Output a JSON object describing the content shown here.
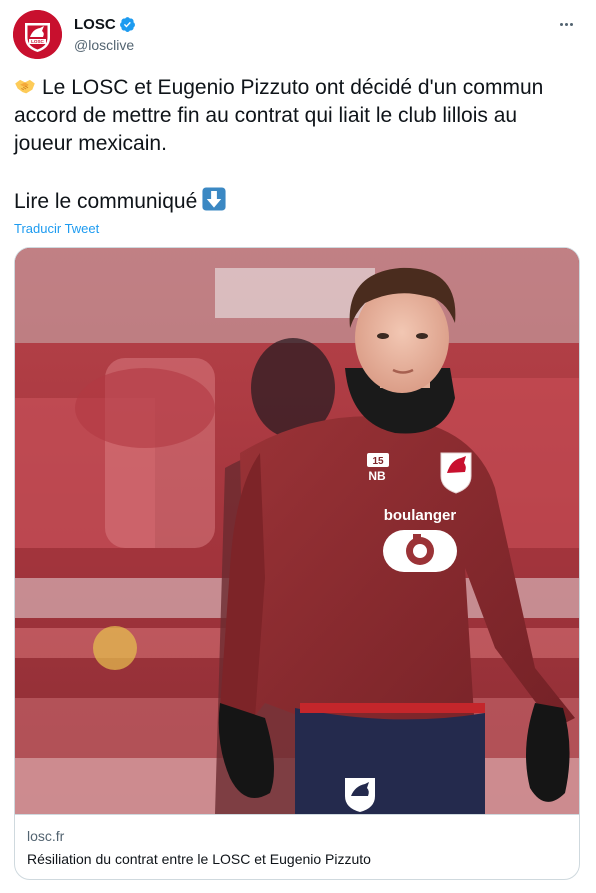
{
  "author": {
    "display_name": "LOSC",
    "handle": "@losclive",
    "verified_icon": "verified-badge-icon",
    "avatar_icon": "losc-crest-icon"
  },
  "tweet": {
    "line1": "Le LOSC et Eugenio Pizzuto ont décidé d'un commun accord de mettre fin au contrat qui liait le club lillois au joueur mexicain.",
    "line2": "Lire le communiqué",
    "leading_emoji": "handshake-emoji",
    "trailing_emoji": "down-arrow-emoji",
    "translate_label": "Traducir Tweet"
  },
  "card": {
    "domain": "losc.fr",
    "title": "Résiliation du contrat entre le LOSC et Eugenio Pizzuto",
    "image_icon": "player-photo",
    "kit": {
      "sponsor": "boulanger",
      "number_badge": "15",
      "crest": "LOSC"
    }
  },
  "colors": {
    "accent": "#1d9bf0",
    "club_red": "#c8102e",
    "text": "#0f1419",
    "secondary": "#536471"
  }
}
